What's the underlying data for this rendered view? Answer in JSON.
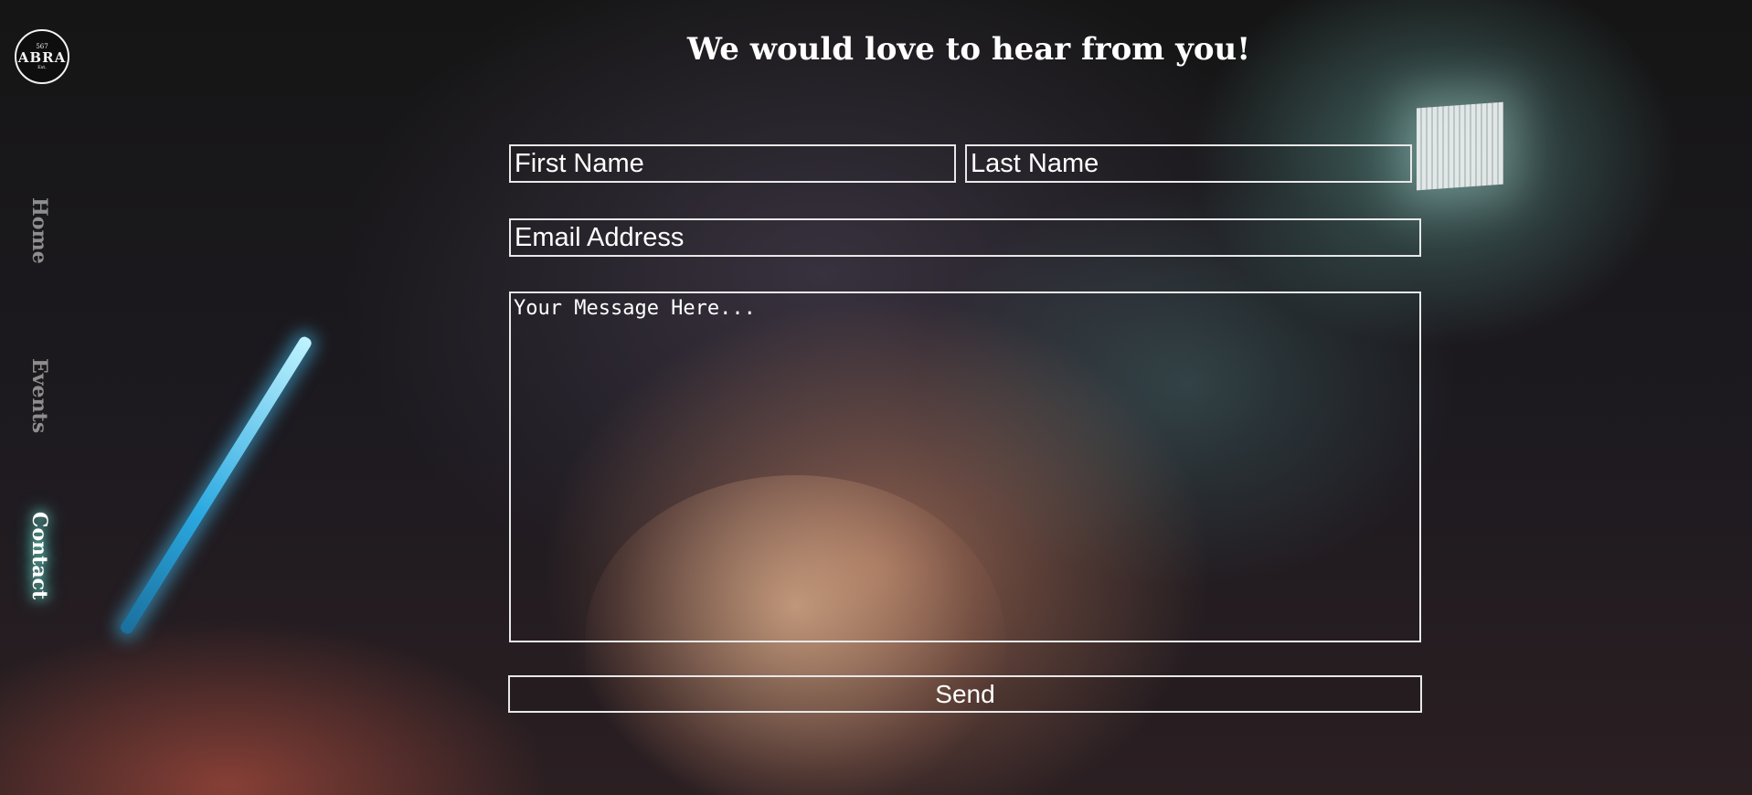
{
  "logo": {
    "number": "567",
    "word": "ABRA",
    "tagline": "Est."
  },
  "nav": {
    "items": [
      {
        "label": "Home",
        "active": false
      },
      {
        "label": "Events",
        "active": false
      },
      {
        "label": "Contact",
        "active": true
      }
    ],
    "active_glow_color": "#7ff2e2"
  },
  "form": {
    "title": "We would love to hear from you!",
    "first_name": {
      "value": "",
      "placeholder": "First Name"
    },
    "last_name": {
      "value": "",
      "placeholder": "Last Name"
    },
    "email": {
      "value": "",
      "placeholder": "Email Address"
    },
    "message": {
      "value": "",
      "placeholder": "Your Message Here..."
    },
    "send_label": "Send"
  }
}
